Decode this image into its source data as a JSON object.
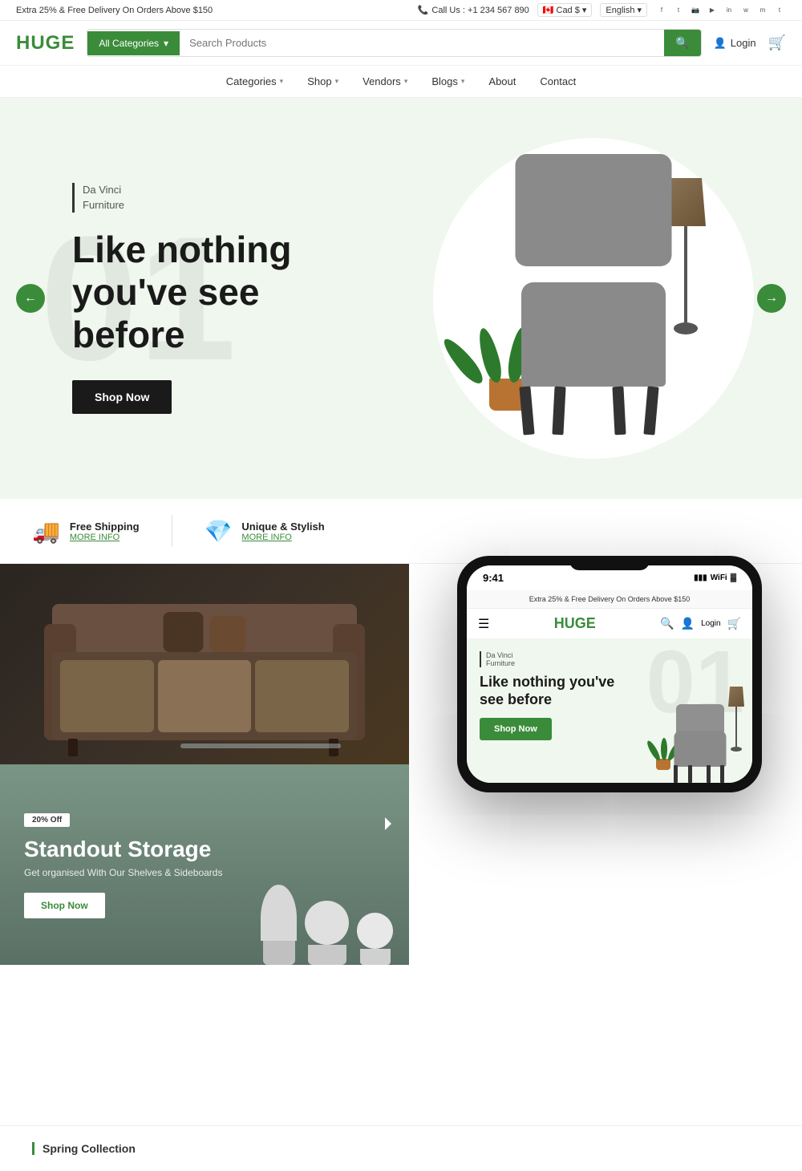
{
  "top_bar": {
    "promo_text": "Extra 25% & Free Delivery On Orders Above $150",
    "phone_label": "Call Us : +1 234 567 890",
    "currency": "Cad $",
    "language": "English",
    "social_icons": [
      "f",
      "t",
      "ig",
      "yt",
      "in",
      "wa",
      "msg",
      "t2"
    ]
  },
  "header": {
    "logo": "HUGE",
    "search_category": "All Categories",
    "search_placeholder": "Search Products",
    "login_label": "Login"
  },
  "nav": {
    "items": [
      {
        "label": "Categories",
        "has_dropdown": true
      },
      {
        "label": "Shop",
        "has_dropdown": true
      },
      {
        "label": "Vendors",
        "has_dropdown": true
      },
      {
        "label": "Blogs",
        "has_dropdown": true
      },
      {
        "label": "About",
        "has_dropdown": false
      },
      {
        "label": "Contact",
        "has_dropdown": false
      }
    ]
  },
  "hero": {
    "slide_number": "01",
    "brand_name": "Da Vinci\nFurniture",
    "title": "Like nothing you've see before",
    "shop_btn": "Shop Now"
  },
  "features": [
    {
      "icon": "🚚",
      "title": "Free Shipping",
      "link": "MORE INFO"
    },
    {
      "icon": "💎",
      "title": "Unique & Stylish",
      "link": "MORE INFO"
    }
  ],
  "panel_storage": {
    "discount": "20% Off",
    "title": "Standout Storage",
    "desc": "Get organised With Our Shelves & Sideboards",
    "shop_btn": "Shop Now"
  },
  "phone_mockup": {
    "time": "9:41",
    "promo": "Extra 25% & Free Delivery On Orders Above $150",
    "logo": "HUGE",
    "brand_name": "Da Vinci\nFurniture",
    "title": "Like nothing you've see before",
    "shop_btn": "Shop Now"
  },
  "spring": {
    "label": "Spring Collection"
  },
  "colors": {
    "green": "#3a8c3a",
    "dark": "#1a1a1a",
    "light_bg": "#f0f7ee"
  }
}
